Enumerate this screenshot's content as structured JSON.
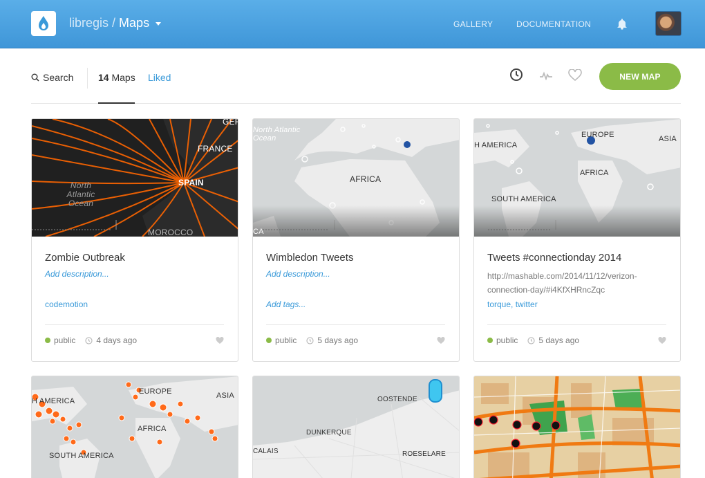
{
  "header": {
    "brand_user": "libregis /",
    "brand_section": "Maps",
    "nav": [
      "GALLERY",
      "DOCUMENTATION"
    ]
  },
  "toolbar": {
    "search_label": "Search",
    "maps_count": "14",
    "maps_label": "Maps",
    "liked_label": "Liked",
    "new_map_label": "NEW MAP"
  },
  "colors": {
    "header": "#4aa3e3",
    "accent_green": "#8bbb47",
    "link_blue": "#3a9ad9",
    "torque_orange": "#ff6600"
  },
  "cards": [
    {
      "title": "Zombie Outbreak",
      "description": "Add description...",
      "tags": "codemotion",
      "privacy": "public",
      "updated": "4 days ago",
      "map_labels": [
        "GER",
        "FRANCE",
        "SPAIN",
        "North Atlantic Ocean",
        "MOROCCO"
      ]
    },
    {
      "title": "Wimbledon Tweets",
      "description": "Add description...",
      "tags": "Add tags...",
      "privacy": "public",
      "updated": "5 days ago",
      "map_labels": [
        "North Atlantic Ocean",
        "AFRICA",
        "CA"
      ]
    },
    {
      "title": "Tweets #connectionday 2014",
      "description": "http://mashable.com/2014/11/12/verizon-connection-day/#i4KfXHRncZqc",
      "tags": "torque, twitter",
      "privacy": "public",
      "updated": "5 days ago",
      "map_labels": [
        "EUROPE",
        "H AMERICA",
        "ASIA",
        "AFRICA",
        "SOUTH AMERICA"
      ]
    },
    {
      "map_labels": [
        "H AMERICA",
        "EUROPE",
        "ASIA",
        "AFRICA",
        "SOUTH AMERICA"
      ]
    },
    {
      "map_labels": [
        "OOSTENDE",
        "DUNKERQUE",
        "CALAIS",
        "ROESELARE"
      ]
    },
    {
      "map_labels": []
    }
  ]
}
